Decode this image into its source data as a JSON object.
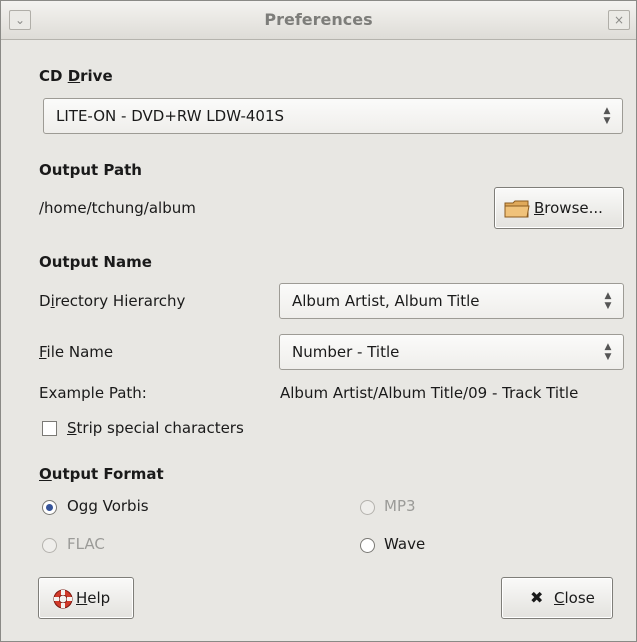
{
  "window": {
    "title": "Preferences",
    "menu_glyph": "⌄",
    "close_glyph": "×"
  },
  "cd_drive": {
    "heading_pre": "CD ",
    "heading_u": "D",
    "heading_post": "rive",
    "value": "LITE-ON - DVD+RW LDW-401S"
  },
  "output_path": {
    "heading": "Output Path",
    "path": "/home/tchung/album",
    "browse_u": "B",
    "browse_rest": "rowse..."
  },
  "output_name": {
    "heading": "Output Name",
    "dir_label_pre": "D",
    "dir_label_u": "i",
    "dir_label_post": "rectory Hierarchy",
    "dir_value": "Album Artist, Album Title",
    "file_label_u": "F",
    "file_label_post": "ile Name",
    "file_value": "Number - Title",
    "example_label": "Example Path:",
    "example_value": "Album Artist/Album Title/09 - Track Title",
    "strip_u": "S",
    "strip_post": "trip special characters",
    "strip_checked": false
  },
  "output_format": {
    "heading_u": "O",
    "heading_post": "utput Format",
    "options": [
      {
        "label": "Ogg Vorbis",
        "selected": true,
        "enabled": true
      },
      {
        "label": "MP3",
        "selected": false,
        "enabled": false
      },
      {
        "label": "FLAC",
        "selected": false,
        "enabled": false
      },
      {
        "label": "Wave",
        "selected": false,
        "enabled": true
      }
    ]
  },
  "buttons": {
    "help_u": "H",
    "help_post": "elp",
    "close_glyph": "✖",
    "close_u": "C",
    "close_post": "lose"
  },
  "colors": {
    "radio_selected": "#36549a",
    "folder": "#e0a95a"
  }
}
